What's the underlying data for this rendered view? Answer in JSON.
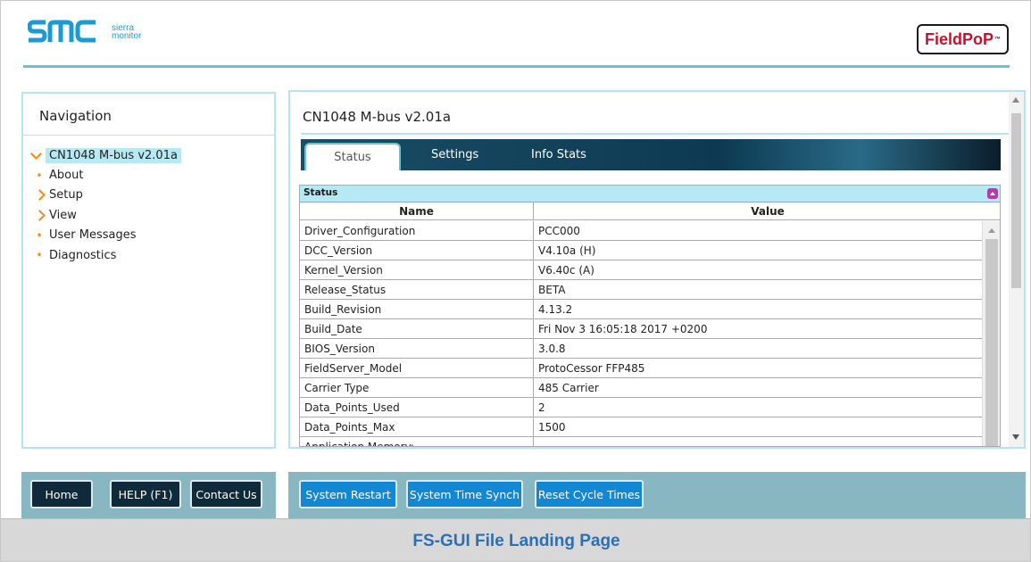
{
  "header": {
    "logo_text": "smc",
    "logo_sub_1": "sierra",
    "logo_sub_2": "monitor",
    "brand_badge": "FieldPoP",
    "brand_tm": "™",
    "colors": {
      "accent": "#66c4cc",
      "logo_blue": "#1b9bd6",
      "badge_red": "#c8102e"
    }
  },
  "navigation": {
    "title": "Navigation",
    "root": "CN1048 M-bus v2.01a",
    "items": [
      {
        "label": "About",
        "icon": "bullet-icon"
      },
      {
        "label": "Setup",
        "icon": "chevron-right-icon"
      },
      {
        "label": "View",
        "icon": "chevron-right-icon"
      },
      {
        "label": "User Messages",
        "icon": "bullet-icon"
      },
      {
        "label": "Diagnostics",
        "icon": "bullet-icon"
      }
    ]
  },
  "main": {
    "title": "CN1048 M-bus v2.01a",
    "tabs": [
      {
        "label": "Status",
        "active": true
      },
      {
        "label": "Settings",
        "active": false
      },
      {
        "label": "Info Stats",
        "active": false
      }
    ],
    "table": {
      "caption": "Status",
      "columns": [
        "Name",
        "Value"
      ],
      "rows": [
        [
          "Driver_Configuration",
          "PCC000"
        ],
        [
          "DCC_Version",
          "V4.10a (H)"
        ],
        [
          "Kernel_Version",
          "V6.40c (A)"
        ],
        [
          "Release_Status",
          "BETA"
        ],
        [
          "Build_Revision",
          "4.13.2"
        ],
        [
          "Build_Date",
          "Fri Nov 3 16:05:18 2017 +0200"
        ],
        [
          "BIOS_Version",
          "3.0.8"
        ],
        [
          "FieldServer_Model",
          "ProtoCessor FFP485"
        ],
        [
          "Carrier Type",
          "485 Carrier"
        ],
        [
          "Data_Points_Used",
          "2"
        ],
        [
          "Data_Points_Max",
          "1500"
        ],
        [
          "Application Memory:",
          ""
        ]
      ]
    }
  },
  "footer": {
    "left_buttons": [
      "Home",
      "HELP (F1)",
      "Contact Us"
    ],
    "right_buttons": [
      "System Restart",
      "System Time Synch",
      "Reset Cycle Times"
    ]
  },
  "caption": "FS-GUI File Landing Page"
}
